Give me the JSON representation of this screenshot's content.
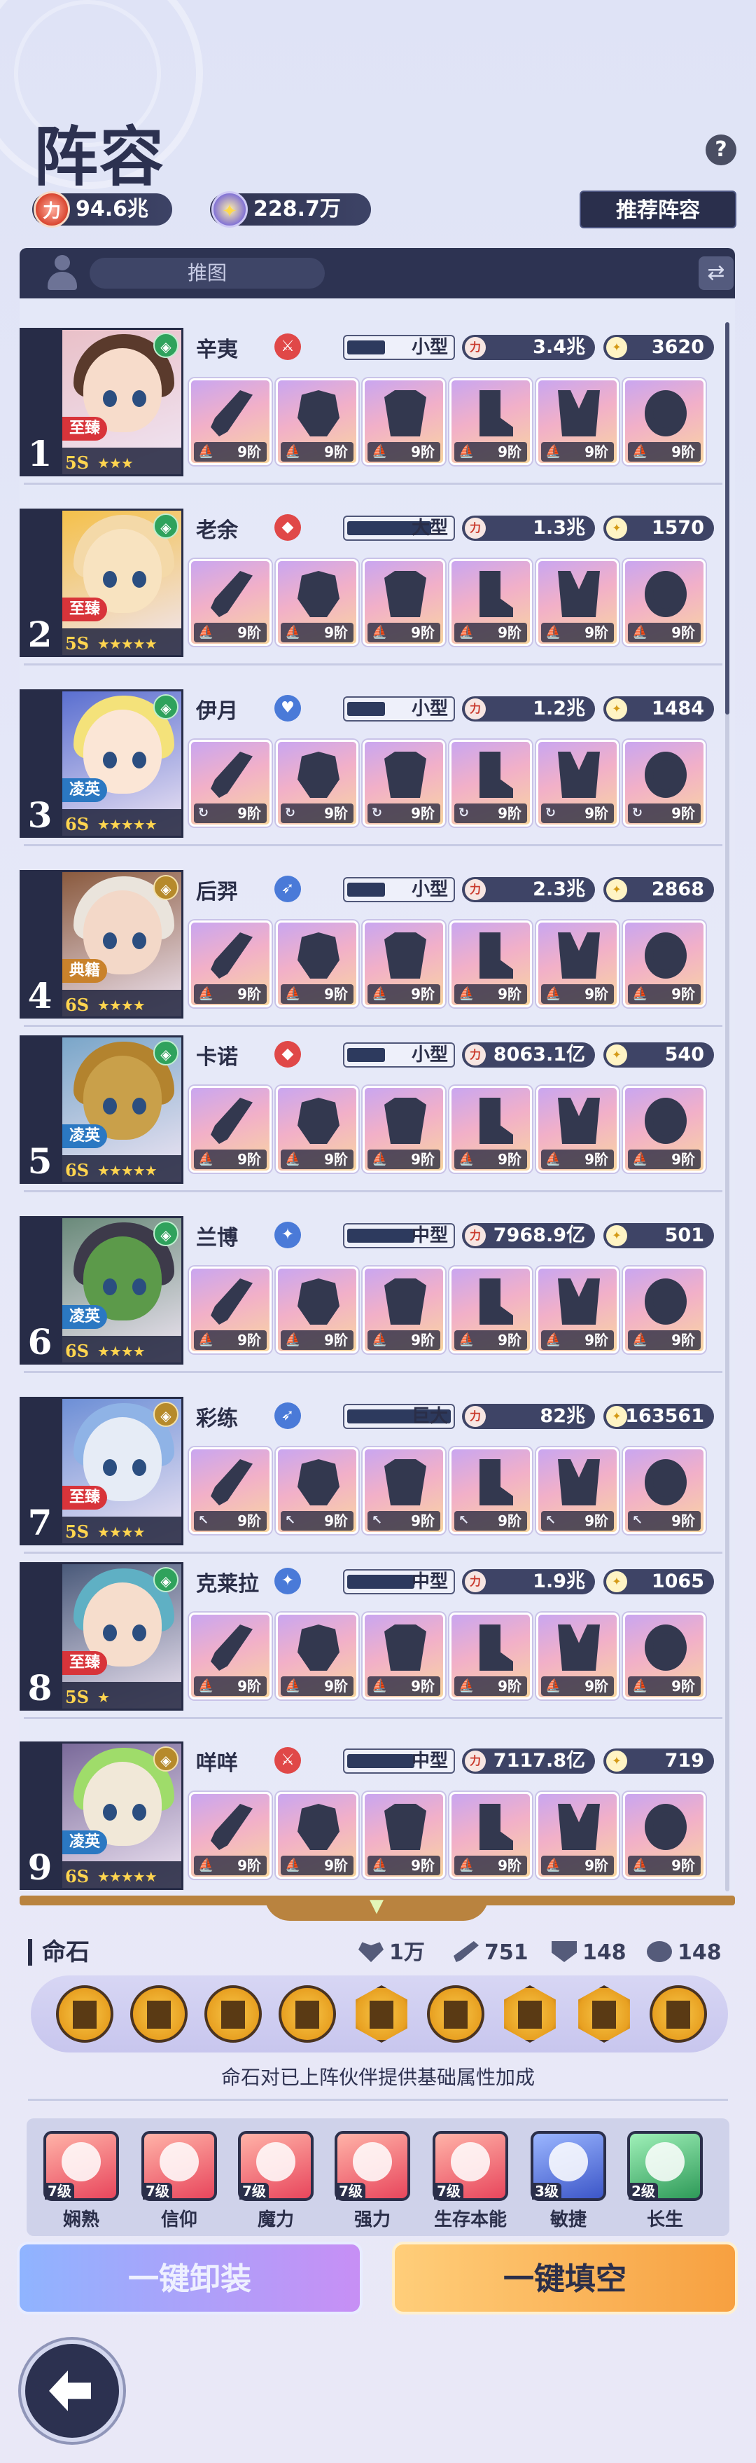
{
  "header": {
    "title": "阵容",
    "help_label": "?",
    "power_total": "94.6兆",
    "star_total": "228.7万",
    "recommend_label": "推荐阵容"
  },
  "tabs": {
    "active_label": "推图"
  },
  "heroes": [
    {
      "rank": "1",
      "name": "辛夷",
      "rarity": "至臻",
      "level": "5S",
      "stars": "★★★",
      "size": "小型",
      "power": "3.4兆",
      "score": "3620",
      "tier": "9阶"
    },
    {
      "rank": "2",
      "name": "老余",
      "rarity": "至臻",
      "level": "5S",
      "stars": "★★★★★",
      "size": "大型",
      "power": "1.3兆",
      "score": "1570",
      "tier": "9阶"
    },
    {
      "rank": "3",
      "name": "伊月",
      "rarity": "凌英",
      "level": "6S",
      "stars": "★★★★★",
      "size": "小型",
      "power": "1.2兆",
      "score": "1484",
      "tier": "9阶"
    },
    {
      "rank": "4",
      "name": "后羿",
      "rarity": "典籍",
      "level": "6S",
      "stars": "★★★★",
      "size": "小型",
      "power": "2.3兆",
      "score": "2868",
      "tier": "9阶"
    },
    {
      "rank": "5",
      "name": "卡诺",
      "rarity": "凌英",
      "level": "6S",
      "stars": "★★★★★",
      "size": "小型",
      "power": "8063.1亿",
      "score": "540",
      "tier": "9阶"
    },
    {
      "rank": "6",
      "name": "兰博",
      "rarity": "凌英",
      "level": "6S",
      "stars": "★★★★",
      "size": "中型",
      "power": "7968.9亿",
      "score": "501",
      "tier": "9阶"
    },
    {
      "rank": "7",
      "name": "彩练",
      "rarity": "至臻",
      "level": "5S",
      "stars": "★★★★",
      "size": "巨大",
      "power": "82兆",
      "score": "163561",
      "tier": "9阶"
    },
    {
      "rank": "8",
      "name": "克莱拉",
      "rarity": "至臻",
      "level": "5S",
      "stars": "★",
      "size": "中型",
      "power": "1.9兆",
      "score": "1065",
      "tier": "9阶"
    },
    {
      "rank": "9",
      "name": "咩咩",
      "rarity": "凌英",
      "level": "6S",
      "stars": "★★★★★",
      "size": "中型",
      "power": "7117.8亿",
      "score": "719",
      "tier": "9阶"
    }
  ],
  "fate": {
    "title": "命石",
    "hp": "1万",
    "atk": "751",
    "def": "148",
    "spd": "148",
    "description": "命石对已上阵伙伴提供基础属性加成"
  },
  "attributes": [
    {
      "level": "7级",
      "label": "娴熟"
    },
    {
      "level": "7级",
      "label": "信仰"
    },
    {
      "level": "7级",
      "label": "魔力"
    },
    {
      "level": "7级",
      "label": "强力"
    },
    {
      "level": "7级",
      "label": "生存本能"
    },
    {
      "level": "3级",
      "label": "敏捷"
    },
    {
      "level": "2级",
      "label": "长生"
    }
  ],
  "actions": {
    "unequip_label": "一键卸装",
    "fill_label": "一键填空"
  }
}
